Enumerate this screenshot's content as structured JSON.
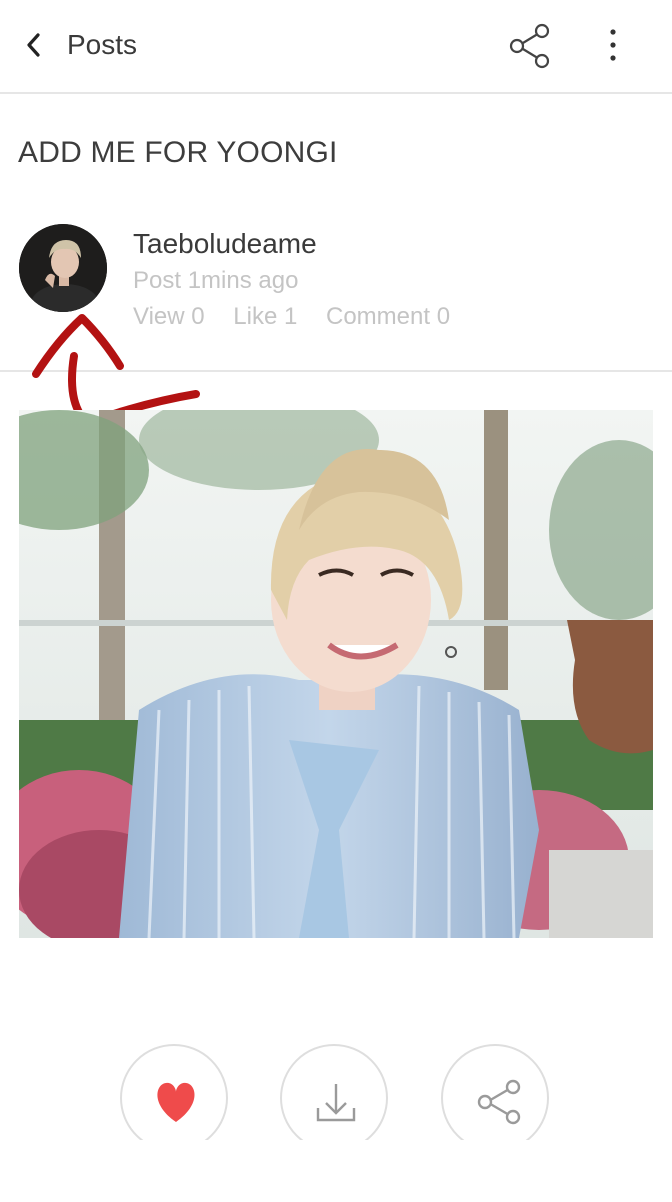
{
  "topbar": {
    "title": "Posts"
  },
  "post": {
    "title": "ADD ME FOR YOONGI",
    "author": "Taeboludeame",
    "time": "Post 1mins ago",
    "stats": {
      "views": "View 0",
      "likes": "Like 1",
      "comments": "Comment 0"
    }
  },
  "icons": {
    "back": "chevron-left-icon",
    "share": "share-icon",
    "more": "more-vertical-icon",
    "like": "heart-icon",
    "download": "download-icon"
  },
  "colors": {
    "heart": "#ef4b4b",
    "annotation": "#b31212",
    "divider": "#e6e6e6",
    "muted_text": "#c4c4c4"
  }
}
